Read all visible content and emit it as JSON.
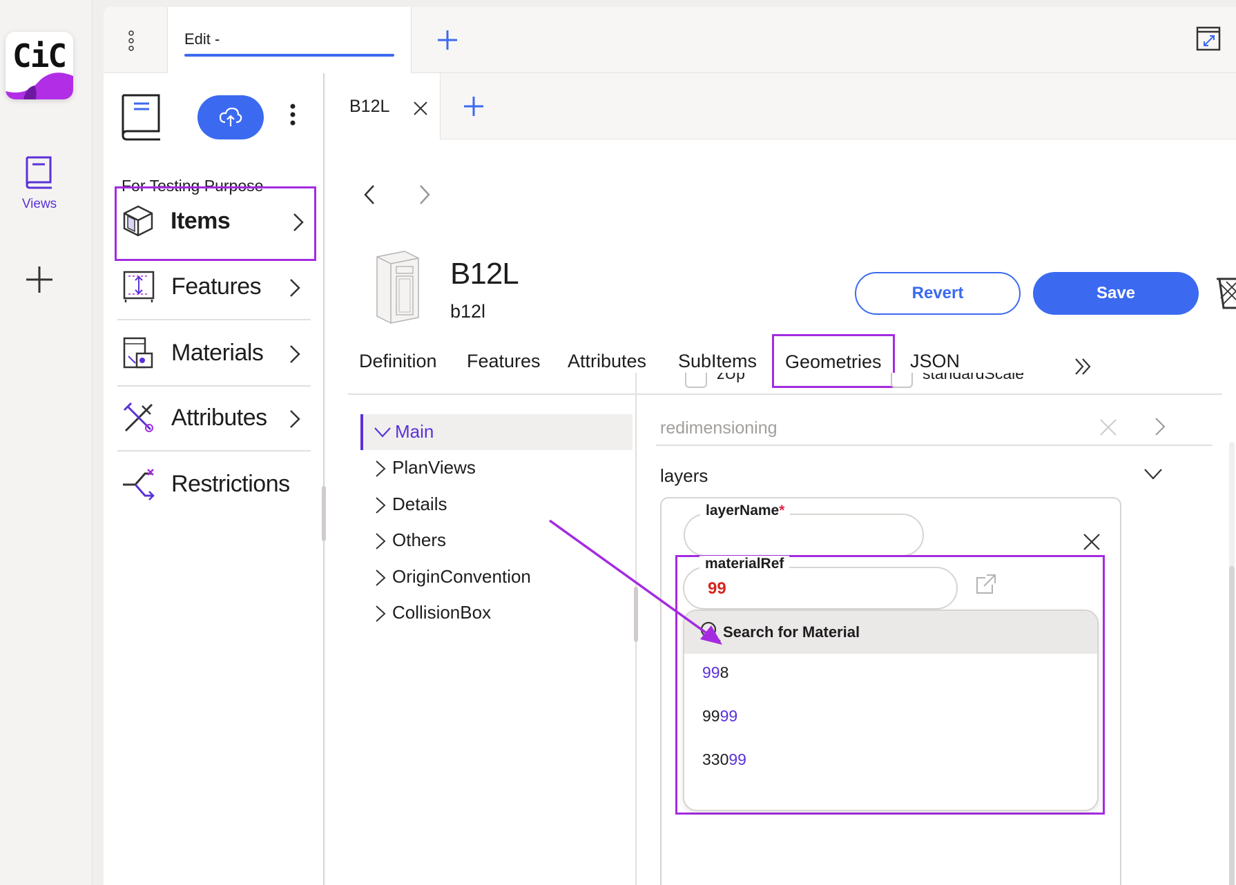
{
  "rail": {
    "logo_text": "CiC",
    "views_label": "Views"
  },
  "outer_tabs": {
    "edit_tab_label": "Edit -"
  },
  "panel": {
    "title": "For Testing Purpose",
    "nav": [
      {
        "label": "Items",
        "active": true
      },
      {
        "label": "Features"
      },
      {
        "label": "Materials"
      },
      {
        "label": "Attributes"
      },
      {
        "label": "Restrictions"
      }
    ]
  },
  "detail": {
    "tab_label": "B12L",
    "item_title": "B12L",
    "item_subtitle": "b12l",
    "revert_label": "Revert",
    "save_label": "Save",
    "tabs": [
      "Definition",
      "Features",
      "Attributes",
      "SubItems",
      "Geometries",
      "JSON"
    ],
    "active_tab": "Geometries"
  },
  "tree": {
    "items": [
      "Main",
      "PlanViews",
      "Details",
      "Others",
      "OriginConvention",
      "CollisionBox"
    ],
    "selected": "Main"
  },
  "form": {
    "checkbox_1": "zUp",
    "checkbox_2": "standardScale",
    "redimensioning_label": "redimensioning",
    "layers_label": "layers",
    "layer_name_label": "layerName",
    "required_mark": "*",
    "material_ref_label": "materialRef",
    "material_ref_value": "99",
    "search_label": "Search for Material",
    "options": [
      {
        "pre": "",
        "hl": "99",
        "post": "8"
      },
      {
        "pre": "99",
        "hl": "99",
        "post": ""
      },
      {
        "pre": "330",
        "hl": "99",
        "post": ""
      }
    ]
  },
  "colors": {
    "accent_blue": "#3b6af0",
    "highlight_purple": "#a42be0",
    "link_purple": "#5a32d8",
    "error_red": "#d4251f"
  }
}
